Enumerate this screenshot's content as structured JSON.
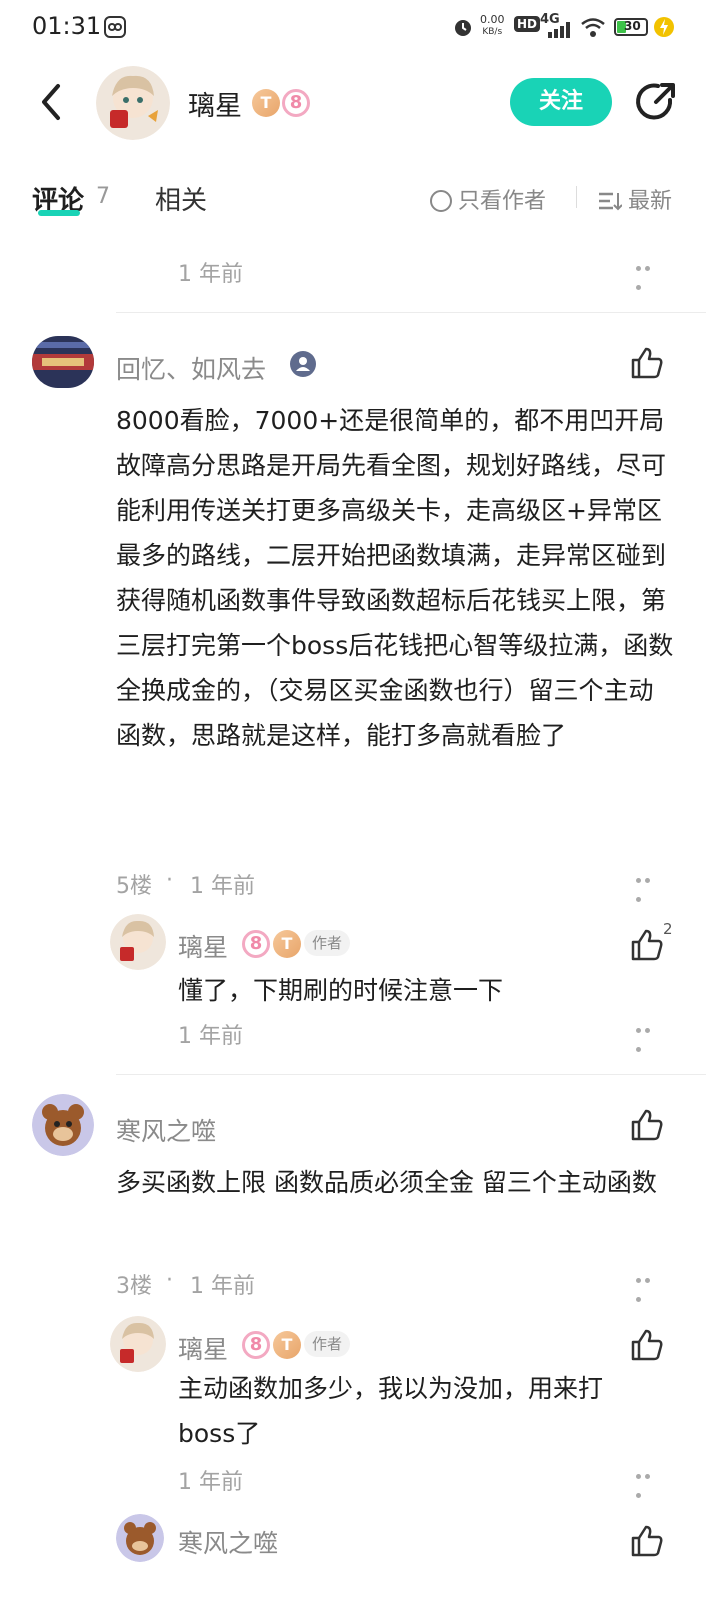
{
  "status_bar": {
    "time": "01:31",
    "net_speed": "0.00",
    "net_unit": "KB/s",
    "hd": "HD",
    "signal": "4G",
    "battery": "30"
  },
  "header": {
    "author_name": "璃星",
    "badge_t": "T",
    "badge_level": "8",
    "follow_label": "关注"
  },
  "tabs": {
    "comments_label": "评论",
    "comments_count": "7",
    "related_label": "相关",
    "only_author_label": "只看作者",
    "sort_label": "最新"
  },
  "top_partial": {
    "time": "1 年前"
  },
  "comments": [
    {
      "name": "回忆、如风去",
      "text": "8000看脸，7000+还是很简单的，都不用凹开局\n故障高分思路是开局先看全图，规划好路线，尽可能利用传送关打更多高级关卡，走高级区+异常区最多的路线，二层开始把函数填满，走异常区碰到获得随机函数事件导致函数超标后花钱买上限，第三层打完第一个boss后花钱把心智等级拉满，函数全换成金的，（交易区买金函数也行）留三个主动函数，思路就是这样，能打多高就看脸了",
      "floor": "5楼",
      "time": "1 年前",
      "reply": {
        "name": "璃星",
        "badge_level": "8",
        "badge_t": "T",
        "tag": "作者",
        "text": "懂了，下期刷的时候注意一下",
        "time": "1 年前",
        "likes": "2"
      }
    },
    {
      "name": "寒风之噬",
      "text": "多买函数上限 函数品质必须全金 留三个主动函数",
      "floor": "3楼",
      "time": "1 年前",
      "reply": {
        "name": "璃星",
        "badge_level": "8",
        "badge_t": "T",
        "tag": "作者",
        "text": "主动函数加多少，我以为没加，用来打boss了",
        "time": "1 年前"
      },
      "reply2": {
        "name": "寒风之噬"
      }
    }
  ],
  "colors": {
    "accent": "#19d3b6",
    "muted": "#a3a3a3"
  }
}
